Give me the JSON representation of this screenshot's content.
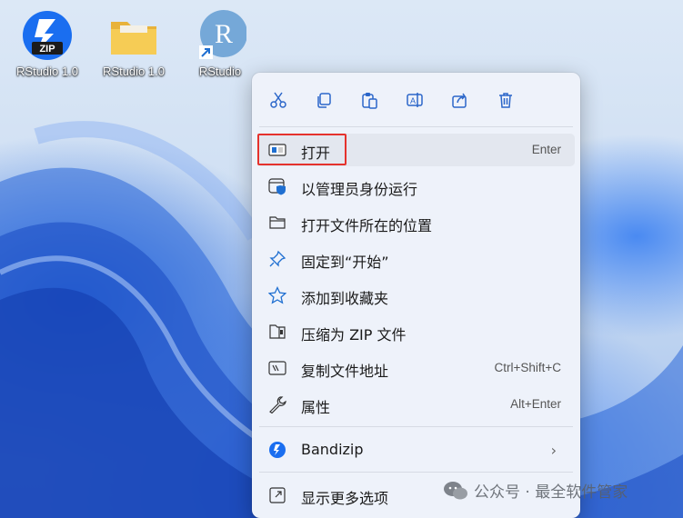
{
  "desktop": {
    "icons": [
      {
        "label": "RStudio 1.0",
        "icon": "zip-archive-icon"
      },
      {
        "label": "RStudio 1.0",
        "icon": "folder-icon"
      },
      {
        "label": "RStudio",
        "icon": "r-app-shortcut-icon"
      }
    ]
  },
  "menu": {
    "toolbar": [
      "cut-icon",
      "copy-icon",
      "paste-icon",
      "rename-icon",
      "share-icon",
      "delete-icon"
    ],
    "items": [
      {
        "label": "打开",
        "shortcut": "Enter",
        "icon": "open-window-icon"
      },
      {
        "label": "以管理员身份运行",
        "shortcut": "",
        "icon": "admin-shield-icon"
      },
      {
        "label": "打开文件所在的位置",
        "shortcut": "",
        "icon": "folder-open-icon"
      },
      {
        "label": "固定到“开始”",
        "shortcut": "",
        "icon": "pin-icon"
      },
      {
        "label": "添加到收藏夹",
        "shortcut": "",
        "icon": "star-icon"
      },
      {
        "label": "压缩为 ZIP 文件",
        "shortcut": "",
        "icon": "zip-folder-icon"
      },
      {
        "label": "复制文件地址",
        "shortcut": "Ctrl+Shift+C",
        "icon": "copy-path-icon"
      },
      {
        "label": "属性",
        "shortcut": "Alt+Enter",
        "icon": "wrench-icon"
      },
      {
        "label": "Bandizip",
        "shortcut": "",
        "icon": "bandizip-icon"
      },
      {
        "label": "显示更多选项",
        "shortcut": "",
        "icon": "more-options-icon"
      }
    ]
  },
  "watermark": {
    "text": "公众号 · 最全软件管家"
  },
  "colors": {
    "accent": "#e5322d",
    "menu_bg": "#eef2fa",
    "icon_blue": "#1f6fd1"
  }
}
